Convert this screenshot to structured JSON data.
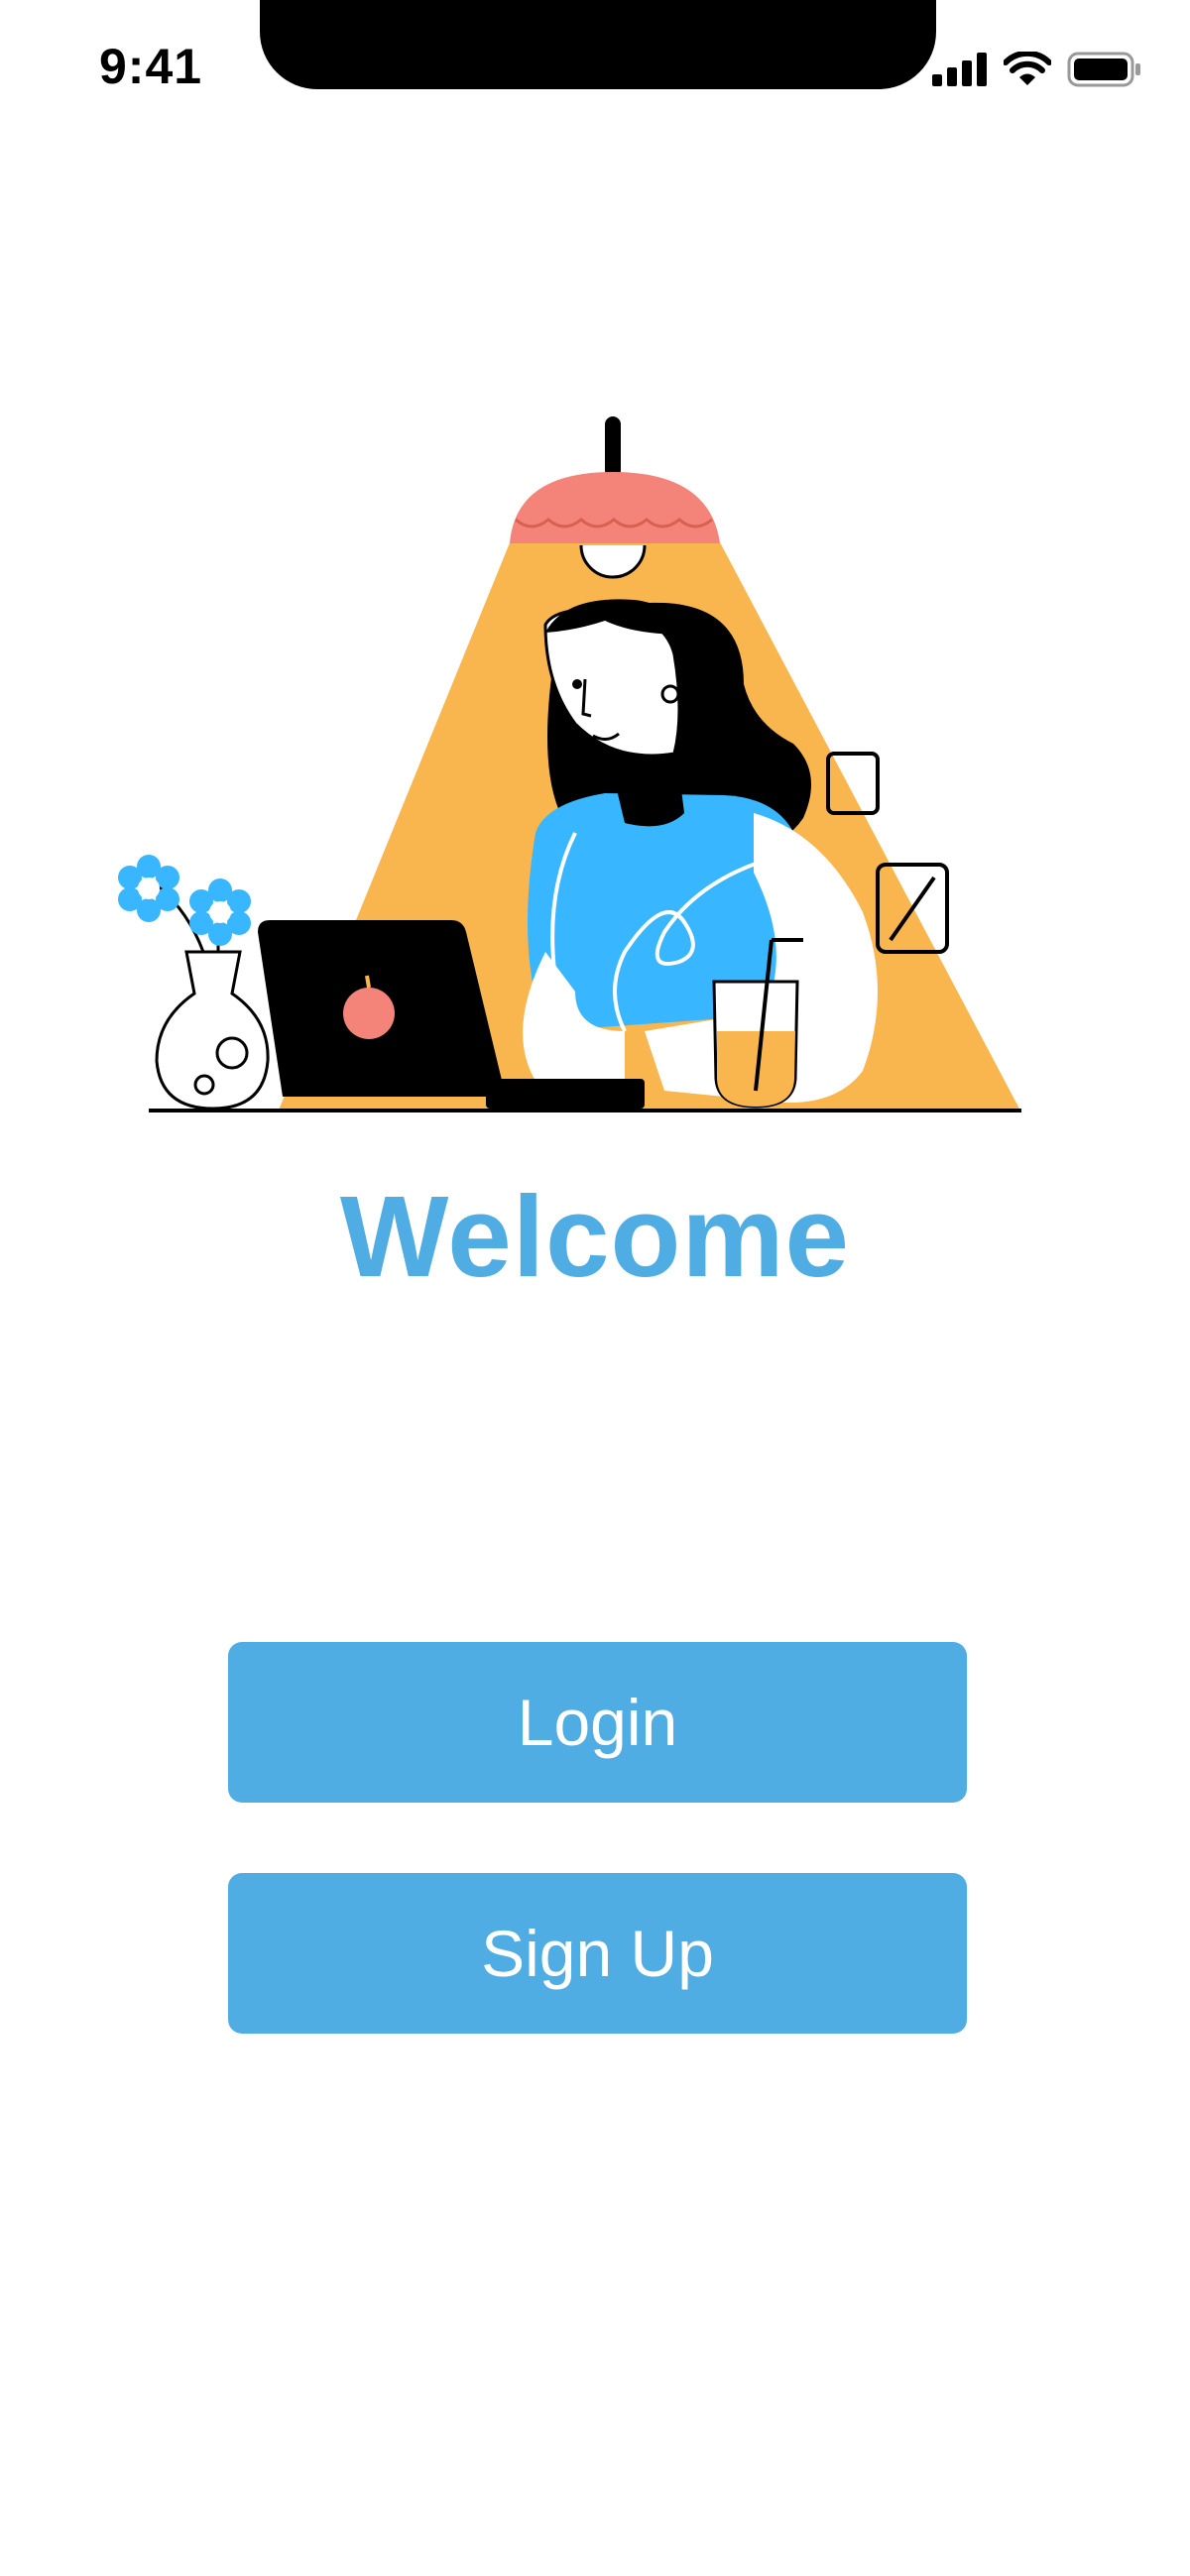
{
  "status_bar": {
    "time": "9:41",
    "icons": [
      "cellular-signal-icon",
      "wifi-icon",
      "battery-icon"
    ]
  },
  "illustration": {
    "description_icon": "woman-working-at-laptop-illustration"
  },
  "welcome": {
    "title": "Welcome"
  },
  "actions": {
    "login_label": "Login",
    "signup_label": "Sign Up"
  },
  "colors": {
    "accent": "#4fade3",
    "lamp_light": "#f9b64f",
    "lamp_shade": "#f4847a",
    "shirt": "#38b6ff",
    "background": "#ffffff"
  }
}
